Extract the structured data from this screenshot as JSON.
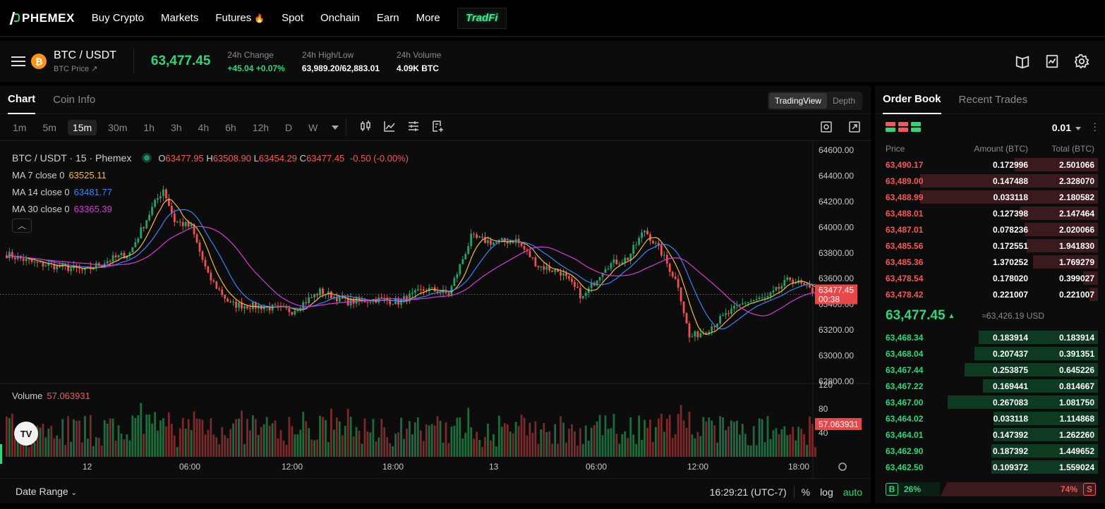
{
  "nav": {
    "logo": "PHEMEX",
    "items": [
      "Buy Crypto",
      "Markets",
      "Futures",
      "Spot",
      "Onchain",
      "Earn",
      "More"
    ],
    "tradfi": "TradFi"
  },
  "ticker": {
    "pair": "BTC / USDT",
    "sub": "BTC Price ↗",
    "coin_symbol": "₿",
    "last_price": "63,477.45",
    "change_label": "24h Change",
    "change_value": "+45.04 +0.07%",
    "highlow_label": "24h High/Low",
    "highlow_value": "63,989.20/62,883.01",
    "volume_label": "24h Volume",
    "volume_value": "4.09K BTC"
  },
  "chart_tabs": [
    "Chart",
    "Coin Info"
  ],
  "view_toggle": [
    "TradingView",
    "Depth"
  ],
  "intervals": [
    "1m",
    "5m",
    "15m",
    "30m",
    "1h",
    "3h",
    "4h",
    "6h",
    "12h",
    "D",
    "W"
  ],
  "selected_interval": "15m",
  "legend": {
    "title": "BTC / USDT · 15 · Phemex",
    "o_lbl": "O",
    "o": "63477.95",
    "h_lbl": "H",
    "h": "63508.90",
    "l_lbl": "L",
    "l": "63454.29",
    "c_lbl": "C",
    "c": "63477.45",
    "chg": "-0.50 (-0.00%)",
    "ma7_lbl": "MA 7 close 0",
    "ma7": "63525.11",
    "ma14_lbl": "MA 14 close 0",
    "ma14": "63481.77",
    "ma30_lbl": "MA 30 close 0",
    "ma30": "63365.39",
    "volume_lbl": "Volume",
    "volume": "57.063931"
  },
  "colors": {
    "up": "#26a269",
    "down": "#ef5350",
    "ma7": "#f5b942",
    "ma14": "#3b82f6",
    "ma30": "#d63ad6",
    "accent": "#2fd67a"
  },
  "chart_data": {
    "type": "candlestick",
    "price_ticks": [
      "64600.00",
      "64400.00",
      "64200.00",
      "64000.00",
      "63800.00",
      "63600.00",
      "63400.00",
      "63200.00",
      "63000.00",
      "62800.00"
    ],
    "volume_ticks": [
      "120",
      "80",
      "40"
    ],
    "time_ticks": [
      "12",
      "06:00",
      "12:00",
      "18:00",
      "13",
      "06:00",
      "12:00",
      "18:00"
    ],
    "last_price_label": "63477.45",
    "countdown": "00:38",
    "last_volume_label": "57.063931",
    "ylim": [
      62700,
      64700
    ],
    "closes_anchor": [
      [
        0,
        63790
      ],
      [
        10,
        63720
      ],
      [
        20,
        63690
      ],
      [
        28,
        63660
      ],
      [
        36,
        63740
      ],
      [
        44,
        63800
      ],
      [
        52,
        64150
      ],
      [
        56,
        64300
      ],
      [
        60,
        64050
      ],
      [
        66,
        64000
      ],
      [
        72,
        63620
      ],
      [
        80,
        63400
      ],
      [
        92,
        63380
      ],
      [
        102,
        63350
      ],
      [
        112,
        63500
      ],
      [
        122,
        63420
      ],
      [
        132,
        63440
      ],
      [
        140,
        63420
      ],
      [
        150,
        63520
      ],
      [
        158,
        63480
      ],
      [
        166,
        63920
      ],
      [
        174,
        63880
      ],
      [
        182,
        63900
      ],
      [
        190,
        63700
      ],
      [
        198,
        63650
      ],
      [
        206,
        63450
      ],
      [
        214,
        63700
      ],
      [
        222,
        63760
      ],
      [
        228,
        63980
      ],
      [
        234,
        63800
      ],
      [
        240,
        63550
      ],
      [
        244,
        63140
      ],
      [
        250,
        63200
      ],
      [
        256,
        63300
      ],
      [
        264,
        63420
      ],
      [
        272,
        63450
      ],
      [
        280,
        63600
      ],
      [
        290,
        63477
      ]
    ]
  },
  "bottom": {
    "date_range": "Date Range",
    "time": "16:29:21 (UTC-7)",
    "pct": "%",
    "log": "log",
    "auto": "auto"
  },
  "orderbook": {
    "tabs": [
      "Order Book",
      "Recent Trades"
    ],
    "precision": "0.01",
    "headers": [
      "Price",
      "Amount (BTC)",
      "Total (BTC)"
    ],
    "asks": [
      {
        "price": "63,490.17",
        "amount": "0.172996",
        "total": "2.501066",
        "depth": 0.4
      },
      {
        "price": "63,489.00",
        "amount": "0.147488",
        "total": "2.328070",
        "depth": 0.85
      },
      {
        "price": "63,488.99",
        "amount": "0.033118",
        "total": "2.180582",
        "depth": 0.85
      },
      {
        "price": "63,488.01",
        "amount": "0.127398",
        "total": "2.147464",
        "depth": 0.37
      },
      {
        "price": "63,487.01",
        "amount": "0.078236",
        "total": "2.020066",
        "depth": 0.35
      },
      {
        "price": "63,485.56",
        "amount": "0.172551",
        "total": "1.941830",
        "depth": 0.34
      },
      {
        "price": "63,485.36",
        "amount": "1.370252",
        "total": "1.769279",
        "depth": 0.31
      },
      {
        "price": "63,478.54",
        "amount": "0.178020",
        "total": "0.399027",
        "depth": 0.07
      },
      {
        "price": "63,478.42",
        "amount": "0.221007",
        "total": "0.221007",
        "depth": 0.04
      }
    ],
    "mid_price": "63,477.45",
    "mid_usd": "≈63,426.19 USD",
    "bids": [
      {
        "price": "63,468.34",
        "amount": "0.183914",
        "total": "0.183914",
        "depth": 0.57
      },
      {
        "price": "63,468.04",
        "amount": "0.207437",
        "total": "0.391351",
        "depth": 0.59
      },
      {
        "price": "63,467.44",
        "amount": "0.253875",
        "total": "0.645226",
        "depth": 0.64
      },
      {
        "price": "63,467.22",
        "amount": "0.169441",
        "total": "0.814667",
        "depth": 0.55
      },
      {
        "price": "63,467.00",
        "amount": "0.267083",
        "total": "1.081750",
        "depth": 0.72
      },
      {
        "price": "63,464.02",
        "amount": "0.033118",
        "total": "1.114868",
        "depth": 0.5
      },
      {
        "price": "63,464.01",
        "amount": "0.147392",
        "total": "1.262260",
        "depth": 0.5
      },
      {
        "price": "63,462.90",
        "amount": "0.187392",
        "total": "1.449652",
        "depth": 0.51
      },
      {
        "price": "63,462.50",
        "amount": "0.109372",
        "total": "1.559024",
        "depth": 0.51
      }
    ],
    "buy_label": "B",
    "buy_pct": "26%",
    "sell_pct": "74%",
    "sell_label": "S",
    "buy_fraction": 0.26
  }
}
